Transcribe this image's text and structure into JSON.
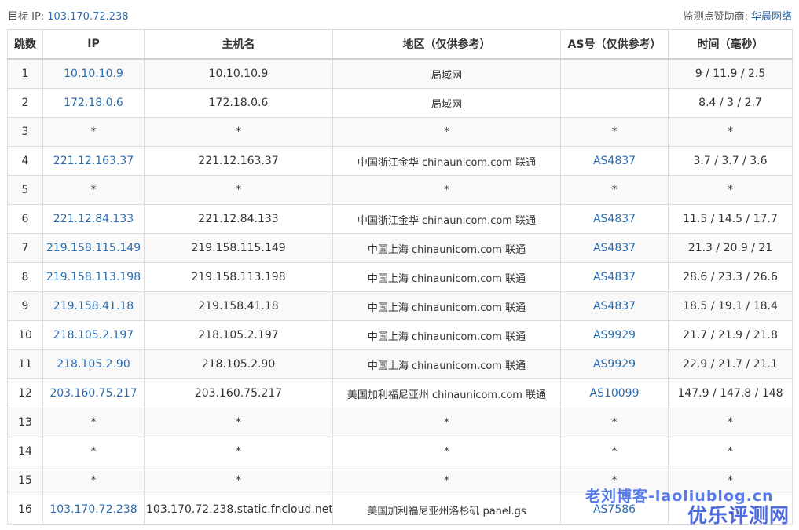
{
  "header": {
    "target_label": "目标 IP:",
    "target_ip": "103.170.72.238",
    "sponsor_label": "监测点赞助商:",
    "sponsor_name": "华晨网络"
  },
  "table": {
    "columns": [
      "跳数",
      "IP",
      "主机名",
      "地区（仅供参考）",
      "AS号（仅供参考）",
      "时间（毫秒）"
    ],
    "rows": [
      {
        "hop": "1",
        "ip": "10.10.10.9",
        "host": "10.10.10.9",
        "region": "局域网",
        "as": "",
        "time": "9 / 11.9 / 2.5"
      },
      {
        "hop": "2",
        "ip": "172.18.0.6",
        "host": "172.18.0.6",
        "region": "局域网",
        "as": "",
        "time": "8.4 / 3 / 2.7"
      },
      {
        "hop": "3",
        "ip": "*",
        "host": "*",
        "region": "*",
        "as": "*",
        "time": "*"
      },
      {
        "hop": "4",
        "ip": "221.12.163.37",
        "host": "221.12.163.37",
        "region": "中国浙江金华 chinaunicom.com 联通",
        "as": "AS4837",
        "time": "3.7 / 3.7 / 3.6"
      },
      {
        "hop": "5",
        "ip": "*",
        "host": "*",
        "region": "*",
        "as": "*",
        "time": "*"
      },
      {
        "hop": "6",
        "ip": "221.12.84.133",
        "host": "221.12.84.133",
        "region": "中国浙江金华 chinaunicom.com 联通",
        "as": "AS4837",
        "time": "11.5 / 14.5 / 17.7"
      },
      {
        "hop": "7",
        "ip": "219.158.115.149",
        "host": "219.158.115.149",
        "region": "中国上海 chinaunicom.com 联通",
        "as": "AS4837",
        "time": "21.3 / 20.9 / 21"
      },
      {
        "hop": "8",
        "ip": "219.158.113.198",
        "host": "219.158.113.198",
        "region": "中国上海 chinaunicom.com 联通",
        "as": "AS4837",
        "time": "28.6 / 23.3 / 26.6"
      },
      {
        "hop": "9",
        "ip": "219.158.41.18",
        "host": "219.158.41.18",
        "region": "中国上海 chinaunicom.com 联通",
        "as": "AS4837",
        "time": "18.5 / 19.1 / 18.4"
      },
      {
        "hop": "10",
        "ip": "218.105.2.197",
        "host": "218.105.2.197",
        "region": "中国上海 chinaunicom.com 联通",
        "as": "AS9929",
        "time": "21.7 / 21.9 / 21.8"
      },
      {
        "hop": "11",
        "ip": "218.105.2.90",
        "host": "218.105.2.90",
        "region": "中国上海 chinaunicom.com 联通",
        "as": "AS9929",
        "time": "22.9 / 21.7 / 21.1"
      },
      {
        "hop": "12",
        "ip": "203.160.75.217",
        "host": "203.160.75.217",
        "region": "美国加利福尼亚州 chinaunicom.com 联通",
        "as": "AS10099",
        "time": "147.9 / 147.8 / 148"
      },
      {
        "hop": "13",
        "ip": "*",
        "host": "*",
        "region": "*",
        "as": "*",
        "time": "*"
      },
      {
        "hop": "14",
        "ip": "*",
        "host": "*",
        "region": "*",
        "as": "*",
        "time": "*"
      },
      {
        "hop": "15",
        "ip": "*",
        "host": "*",
        "region": "*",
        "as": "*",
        "time": "*"
      },
      {
        "hop": "16",
        "ip": "103.170.72.238",
        "host": "103.170.72.238.static.fncloud.net",
        "region": "美国加利福尼亚州洛杉矶 panel.gs",
        "as": "AS7586",
        "time": ""
      }
    ]
  },
  "watermark": {
    "line1": "老刘博客-laoliublog.cn",
    "line2": "优乐评测网"
  }
}
